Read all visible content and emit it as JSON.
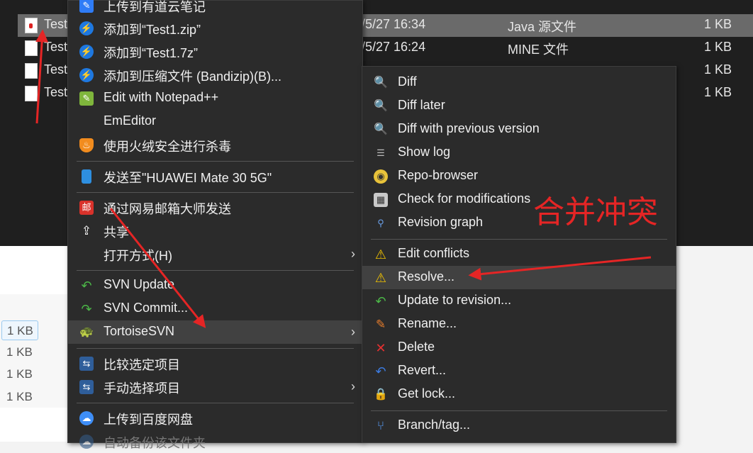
{
  "explorer": {
    "rows": [
      {
        "name": "Test",
        "date": "/5/27 16:34",
        "type": "Java 源文件",
        "size": "1 KB",
        "selected": true
      },
      {
        "name": "Test",
        "date": "/5/27 16:24",
        "type": "MINE 文件",
        "size": "1 KB"
      },
      {
        "name": "Test",
        "date": "",
        "type": "",
        "size": "1 KB"
      },
      {
        "name": "Test",
        "date": "",
        "type": "",
        "size": "1 KB"
      }
    ],
    "light_sizes": [
      "1 KB",
      "1 KB",
      "1 KB",
      "1 KB"
    ]
  },
  "main_menu": {
    "items": [
      {
        "label": "上传到有道云笔记"
      },
      {
        "label": "添加到“Test1.zip”"
      },
      {
        "label": "添加到“Test1.7z”"
      },
      {
        "label": "添加到压缩文件 (Bandizip)(B)..."
      },
      {
        "label": "Edit with Notepad++"
      },
      {
        "label": "EmEditor"
      },
      {
        "label": "使用火绒安全进行杀毒"
      },
      {
        "label": "发送至\"HUAWEI Mate 30 5G\""
      },
      {
        "label": "通过网易邮箱大师发送",
        "icon_text": "邮"
      },
      {
        "label": "共享"
      },
      {
        "label": "打开方式(H)"
      },
      {
        "label": "SVN Update"
      },
      {
        "label": "SVN Commit..."
      },
      {
        "label": "TortoiseSVN"
      },
      {
        "label": "比较选定项目"
      },
      {
        "label": "手动选择项目"
      },
      {
        "label": "上传到百度网盘"
      },
      {
        "label": "自动备份该文件夹"
      }
    ]
  },
  "sub_menu": {
    "items": [
      {
        "label": "Diff"
      },
      {
        "label": "Diff later"
      },
      {
        "label": "Diff with previous version"
      },
      {
        "label": "Show log"
      },
      {
        "label": "Repo-browser"
      },
      {
        "label": "Check for modifications"
      },
      {
        "label": "Revision graph"
      },
      {
        "label": "Edit conflicts"
      },
      {
        "label": "Resolve..."
      },
      {
        "label": "Update to revision..."
      },
      {
        "label": "Rename..."
      },
      {
        "label": "Delete"
      },
      {
        "label": "Revert..."
      },
      {
        "label": "Get lock..."
      },
      {
        "label": "Branch/tag..."
      }
    ]
  },
  "annotation": {
    "text": "合并冲突",
    "color": "#e52525"
  }
}
